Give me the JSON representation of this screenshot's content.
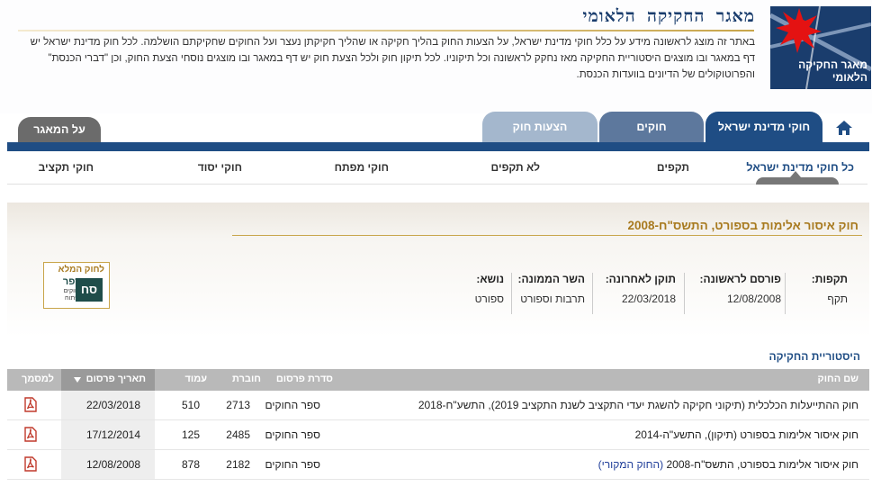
{
  "header": {
    "logo_text": "מאגר החקיקה הלאומי",
    "title": "מאגר החקיקה הלאומי",
    "intro": "באתר זה מוצג לראשונה מידע על כלל חוקי מדינת ישראל, על הצעות החוק בהליך חקיקה או שהליך חקיקתן נעצר ועל החוקים שחקיקתם הושלמה. לכל חוק מדינת ישראל יש דף במאגר ובו מוצגים היסטוריית החקיקה מאז נחקק לראשונה וכל תיקוניו. לכל תיקון חוק ולכל הצעת חוק יש דף במאגר ובו מוצגים נוסחי הצעת החוק, וכן \"דברי הכנסת\" והפרוטוקולים של הדיונים בוועדות הכנסת."
  },
  "tabs": {
    "laws": "חוקי מדינת ישראל",
    "statutes": "חוקים",
    "bills": "הצעות חוק",
    "about": "על המאגר"
  },
  "subnav": {
    "all": "כל חוקי מדינת ישראל",
    "in_force": "תקפים",
    "not_in_force": "לא תקפים",
    "key": "חוקי מפתח",
    "basic": "חוקי יסוד",
    "budget": "חוקי תקציב"
  },
  "law": {
    "title": "חוק איסור אלימות בספורט, התשס\"ח-2008",
    "validity_label": "תקפות:",
    "validity": "תקף",
    "first_published_label": "פורסם לראשונה:",
    "first_published": "12/08/2008",
    "last_amended_label": "תוקן לאחרונה:",
    "last_amended": "22/03/2018",
    "minister_label": "השר הממונה:",
    "minister": "תרבות וספורט",
    "topic_label": "נושא:",
    "topic": "ספורט"
  },
  "book_logo": {
    "line1": "לחוק המלא",
    "line2": "ספר",
    "line3": "החוקים הפתוח",
    "mark": "סח"
  },
  "history": {
    "title": "היסטוריית החקיקה",
    "columns": {
      "name": "שם החוק",
      "series": "סדרת פרסום",
      "booklet": "חוברת",
      "page": "עמוד",
      "date": "תאריך פרסום",
      "doc": "למסמך"
    },
    "rows": [
      {
        "name": "חוק ההתייעלות הכלכלית (תיקוני חקיקה להשגת יעדי התקציב לשנת התקציב 2019), התשע\"ח-2018",
        "link": "",
        "series": "ספר החוקים",
        "booklet": "2713",
        "page": "510",
        "date": "22/03/2018"
      },
      {
        "name": "חוק איסור אלימות בספורט (תיקון), התשע\"ה-2014",
        "link": "",
        "series": "ספר החוקים",
        "booklet": "2485",
        "page": "125",
        "date": "17/12/2014"
      },
      {
        "name": "חוק איסור אלימות בספורט, התשס\"ח-2008",
        "link": "(החוק המקורי)",
        "series": "ספר החוקים",
        "booklet": "2182",
        "page": "878",
        "date": "12/08/2008"
      }
    ]
  },
  "colors": {
    "brand_blue": "#1f4d84",
    "gold": "#a87a1f",
    "pdf_red": "#c0392b"
  }
}
